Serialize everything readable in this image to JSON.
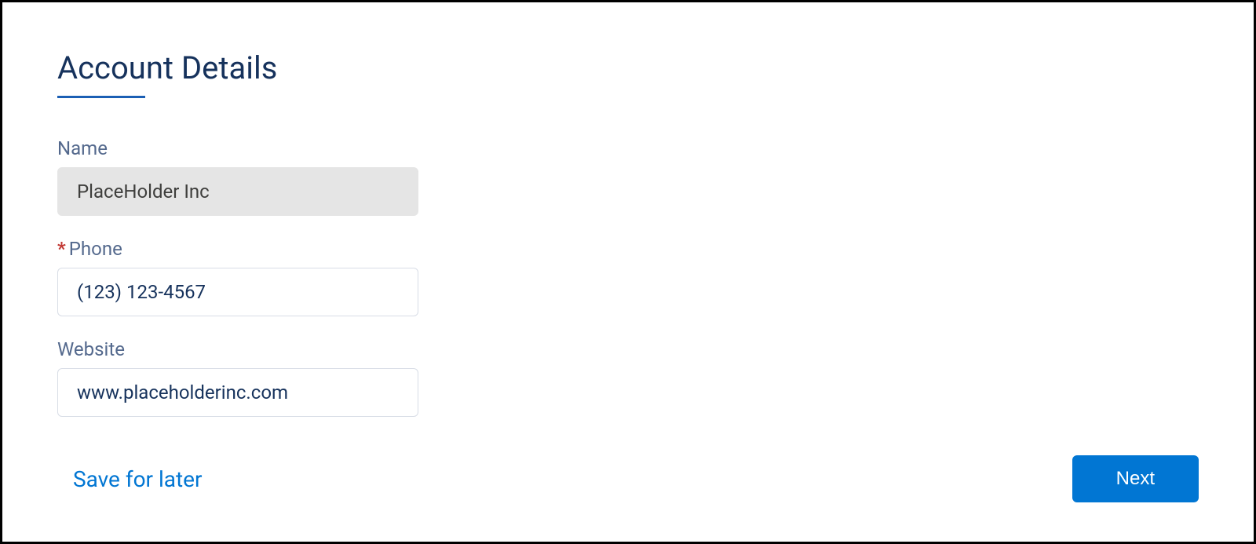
{
  "header": {
    "title": "Account Details"
  },
  "form": {
    "name": {
      "label": "Name",
      "value": "PlaceHolder Inc",
      "required": false,
      "readonly": true
    },
    "phone": {
      "label": "Phone",
      "value": "(123) 123-4567",
      "required": true,
      "readonly": false,
      "required_mark": "*"
    },
    "website": {
      "label": "Website",
      "value": "www.placeholderinc.com",
      "required": false,
      "readonly": false
    }
  },
  "footer": {
    "save_later_label": "Save for later",
    "next_label": "Next"
  }
}
